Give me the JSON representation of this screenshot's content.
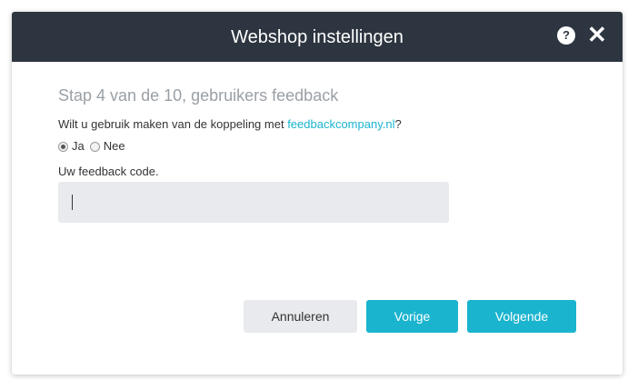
{
  "dialog": {
    "title": "Webshop instellingen",
    "help_label": "?",
    "close_label": "✕"
  },
  "step": {
    "title": "Stap 4 van de 10, gebruikers feedback",
    "question_prefix": "Wilt u gebruik maken van de koppeling met ",
    "question_link": "feedbackcompany.nl",
    "question_suffix": "?"
  },
  "options": {
    "yes_label": "Ja",
    "no_label": "Nee",
    "selected": "Ja"
  },
  "feedback_code": {
    "label": "Uw feedback code.",
    "value": ""
  },
  "buttons": {
    "cancel": "Annuleren",
    "previous": "Vorige",
    "next": "Volgende"
  },
  "colors": {
    "header_bg": "#2d3540",
    "accent": "#1ab4cf",
    "input_bg": "#e8eaee"
  }
}
